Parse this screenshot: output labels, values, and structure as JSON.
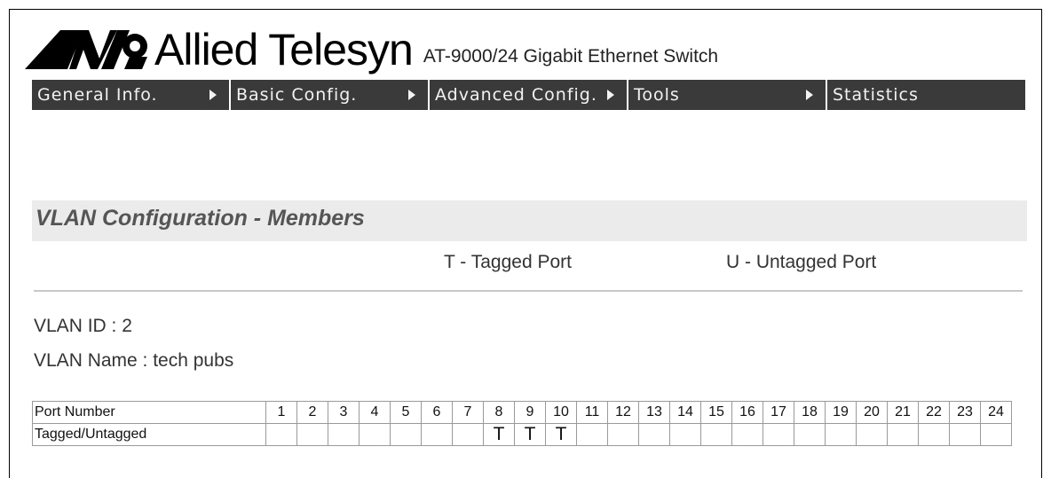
{
  "header": {
    "brand": "Allied Telesyn",
    "product": "AT-9000/24 Gigabit Ethernet Switch"
  },
  "nav": {
    "items": [
      {
        "label": "General Info.",
        "has_arrow": true
      },
      {
        "label": "Basic Config.",
        "has_arrow": true
      },
      {
        "label": "Advanced Config.",
        "has_arrow": true
      },
      {
        "label": "Tools",
        "has_arrow": true
      },
      {
        "label": "Statistics",
        "has_arrow": false
      }
    ]
  },
  "page": {
    "title": "VLAN Configuration - Members",
    "legend_tagged": "T - Tagged Port",
    "legend_untagged": "U - Untagged Port"
  },
  "vlan": {
    "id_line": "VLAN ID : 2",
    "name_line": "VLAN Name : tech pubs"
  },
  "ports": {
    "row1_label": "Port Number",
    "row2_label": "Tagged/Untagged",
    "numbers": [
      "1",
      "2",
      "3",
      "4",
      "5",
      "6",
      "7",
      "8",
      "9",
      "10",
      "11",
      "12",
      "13",
      "14",
      "15",
      "16",
      "17",
      "18",
      "19",
      "20",
      "21",
      "22",
      "23",
      "24"
    ],
    "membership": [
      "",
      "",
      "",
      "",
      "",
      "",
      "",
      "T",
      "T",
      "T",
      "",
      "",
      "",
      "",
      "",
      "",
      "",
      "",
      "",
      "",
      "",
      "",
      "",
      ""
    ]
  },
  "colors": {
    "nav_background": "#3a3a3a",
    "title_band": "#ebebeb",
    "title_text": "#555555"
  },
  "icons": {
    "logo": "allied-telesyn-logo-mark",
    "nav_arrow": "triangle-right-icon"
  }
}
